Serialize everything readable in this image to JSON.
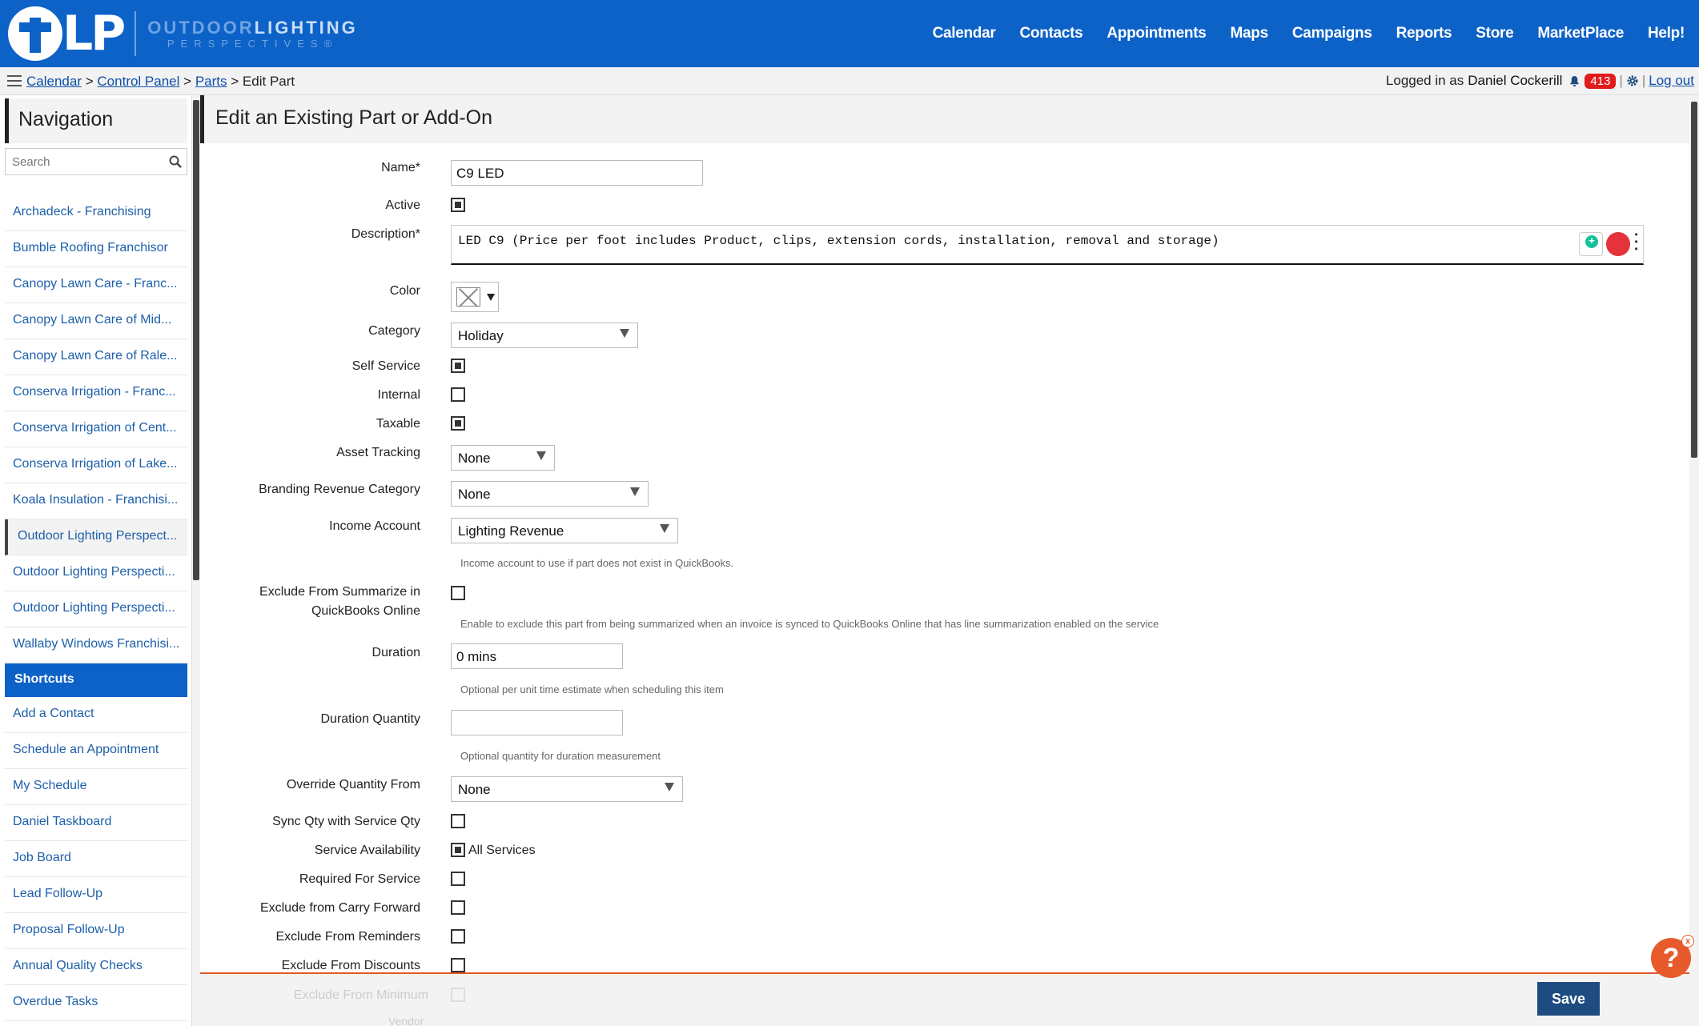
{
  "brand": {
    "logo_letters": "LP",
    "logo_word1_a": "OUTDOOR",
    "logo_word1_b": "LIGHTING",
    "logo_word2": "PERSPECTIVES®",
    "header_color": "#0d62c8"
  },
  "topnav": [
    "Calendar",
    "Contacts",
    "Appointments",
    "Maps",
    "Campaigns",
    "Reports",
    "Store",
    "MarketPlace",
    "Help!"
  ],
  "breadcrumb": {
    "items": [
      "Calendar",
      "Control Panel",
      "Parts"
    ],
    "separator": ">",
    "current": "Edit Part"
  },
  "user": {
    "prefix": "Logged in as",
    "name": "Daniel Cockerill",
    "notifications": "413",
    "separator": "|",
    "logout": "Log out"
  },
  "sidebar": {
    "title": "Navigation",
    "search_placeholder": "Search",
    "franchise_items": [
      "Archadeck - Franchising",
      "Bumble Roofing Franchisor",
      "Canopy Lawn Care - Franc...",
      "Canopy Lawn Care of Mid...",
      "Canopy Lawn Care of Rale...",
      "Conserva Irrigation - Franc...",
      "Conserva Irrigation of Cent...",
      "Conserva Irrigation of Lake...",
      "Koala Insulation - Franchisi...",
      "Outdoor Lighting Perspect...",
      "Outdoor Lighting Perspecti...",
      "Outdoor Lighting Perspecti...",
      "Wallaby Windows Franchisi..."
    ],
    "shortcuts_header": "Shortcuts",
    "shortcuts": [
      "Add a Contact",
      "Schedule an Appointment",
      "My Schedule",
      "Daniel Taskboard",
      "Job Board",
      "Lead Follow-Up",
      "Proposal Follow-Up",
      "Annual Quality Checks",
      "Overdue Tasks"
    ]
  },
  "page": {
    "title": "Edit an Existing Part or Add-On"
  },
  "form": {
    "name_label": "Name*",
    "name_value": "C9 LED",
    "active_label": "Active",
    "active": true,
    "description_label": "Description*",
    "description_value": "LED C9 (Price per foot includes Product, clips, extension cords, installation, removal and storage)",
    "color_label": "Color",
    "category_label": "Category",
    "category_value": "Holiday",
    "self_service_label": "Self Service",
    "self_service": true,
    "internal_label": "Internal",
    "internal": false,
    "taxable_label": "Taxable",
    "taxable": true,
    "asset_tracking_label": "Asset Tracking",
    "asset_tracking_value": "None",
    "branding_label": "Branding Revenue Category",
    "branding_value": "None",
    "income_label": "Income Account",
    "income_value": "Lighting Revenue",
    "income_help": "Income account to use if part does not exist in QuickBooks.",
    "exclude_summarize_label_1": "Exclude From Summarize in",
    "exclude_summarize_label_2": "QuickBooks Online",
    "exclude_summarize": false,
    "exclude_summarize_help": "Enable to exclude this part from being summarized when an invoice is synced to QuickBooks Online that has line summarization enabled on the service",
    "duration_label": "Duration",
    "duration_value": "0 mins",
    "duration_help": "Optional per unit time estimate when scheduling this item",
    "duration_qty_label": "Duration Quantity",
    "duration_qty_value": "",
    "duration_qty_help": "Optional quantity for duration measurement",
    "override_label": "Override Quantity From",
    "override_value": "None",
    "sync_qty_label": "Sync Qty with Service Qty",
    "sync_qty": false,
    "service_avail_label": "Service Availability",
    "service_avail_value": "All Services",
    "service_avail": true,
    "required_label": "Required For Service",
    "required": false,
    "carry_forward_label": "Exclude from Carry Forward",
    "carry_forward": false,
    "reminders_label": "Exclude From Reminders",
    "reminders": false,
    "discounts_label": "Exclude From Discounts",
    "discounts": false,
    "minimum_label": "Exclude From Minimum",
    "vendor_label": "Vendor"
  },
  "actions": {
    "save_label": "Save",
    "help_fab": "?",
    "help_close": "x"
  }
}
